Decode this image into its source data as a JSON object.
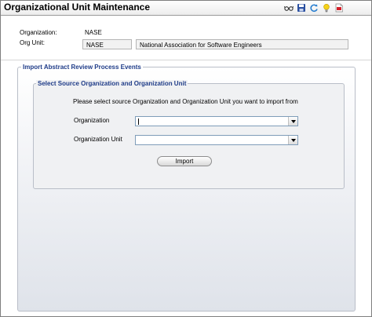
{
  "header": {
    "title": "Organizational Unit Maintenance",
    "toolbar": [
      {
        "icon": "glasses-icon"
      },
      {
        "icon": "save-icon"
      },
      {
        "icon": "refresh-icon"
      },
      {
        "icon": "lightbulb-icon"
      },
      {
        "icon": "pdf-icon"
      }
    ]
  },
  "info": {
    "organization_label": "Organization:",
    "organization_value": "NASE",
    "org_unit_label": "Org Unit:",
    "org_unit_code": "NASE",
    "org_unit_name": "National Association for Software Engineers"
  },
  "import_panel": {
    "legend": "Import Abstract Review Process Events",
    "source_panel": {
      "legend": "Select Source Organization and Organization Unit",
      "instruction": "Please select source Organization and Organization Unit you want to import from",
      "organization_label": "Organization",
      "organization_value": "",
      "organization_unit_label": "Organization Unit",
      "organization_unit_value": "",
      "import_button": "Import"
    }
  },
  "colors": {
    "legend_text": "#1f3c88",
    "select_border": "#7f9db9",
    "panel_border": "#b9bec8"
  }
}
